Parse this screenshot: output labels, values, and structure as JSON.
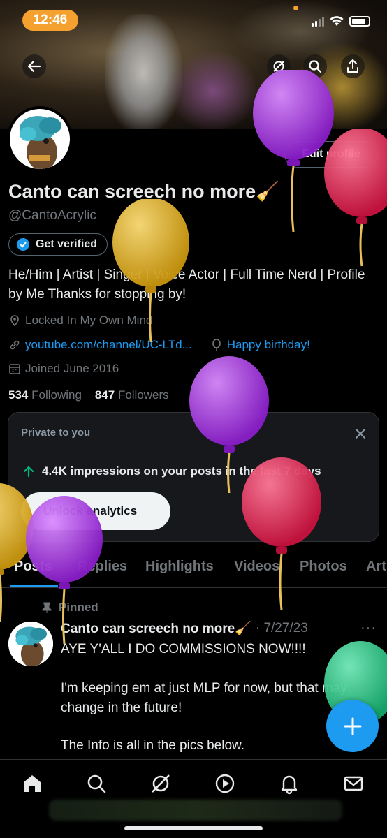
{
  "status_bar": {
    "time": "12:46"
  },
  "profile": {
    "edit_label": "Edit profile",
    "name": "Canto can screech no more🧹",
    "handle": "@CantoAcrylic",
    "verified_label": "Get verified",
    "bio": "He/Him | Artist | Singer | Voice Actor | Full Time Nerd | Profile by Me Thanks for stopping by!",
    "location": "Locked In My Own Mind",
    "link": "youtube.com/channel/UC-LTd...",
    "birthday": "Happy birthday!",
    "joined": "Joined June 2016",
    "following_count": "534",
    "following_label": "Following",
    "followers_count": "847",
    "followers_label": "Followers"
  },
  "analytics_card": {
    "title": "Private to you",
    "impressions": "4.4K impressions on your posts in the last 7 days",
    "button": "Unlock analytics"
  },
  "tabs": [
    "Posts",
    "Replies",
    "Highlights",
    "Videos",
    "Photos",
    "Art"
  ],
  "post": {
    "pinned_label": "Pinned",
    "author": "Canto can screech no more🧹",
    "date": "· 7/27/23",
    "more": "···",
    "lines": [
      "AYE Y'ALL I DO COMMISSIONS NOW!!!!",
      "I'm keeping em at just MLP for now, but that may change in the future!",
      "The Info is all in the pics below."
    ]
  },
  "colors": {
    "accent": "#1d9bf0",
    "background": "#000000",
    "muted": "#71767b",
    "balloon_purple": "#a335e0",
    "balloon_red": "#e8335a",
    "balloon_yellow": "#e8b92a",
    "balloon_green": "#2ecc8a"
  },
  "icons": {
    "back": "arrow-left-icon",
    "grok": "grok-icon",
    "search": "search-icon",
    "share": "share-icon",
    "nav": [
      "home-icon",
      "search-icon",
      "grok-icon",
      "play-icon",
      "bell-icon",
      "mail-icon"
    ]
  }
}
